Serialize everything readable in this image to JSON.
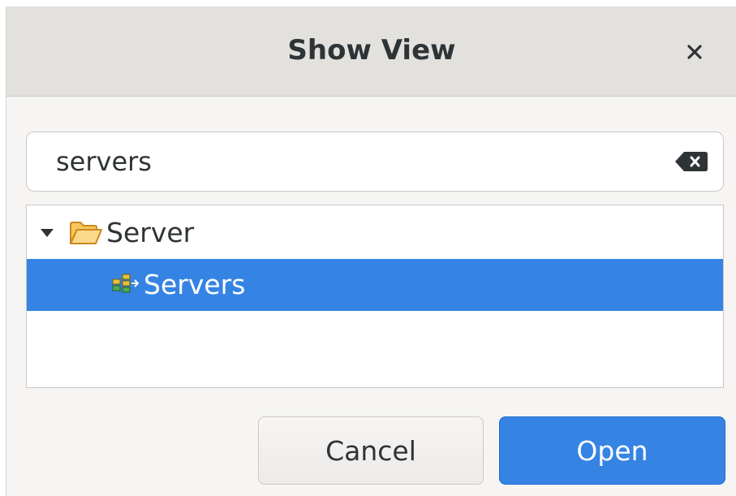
{
  "dialog": {
    "title": "Show View"
  },
  "search": {
    "value": "servers",
    "clear_icon": "clear-text-icon"
  },
  "tree": {
    "items": [
      {
        "label": "Server",
        "icon": "folder-open-icon",
        "expanded": true,
        "selected": false
      },
      {
        "label": "Servers",
        "icon": "servers-view-icon",
        "selected": true
      }
    ]
  },
  "buttons": {
    "cancel_label": "Cancel",
    "open_label": "Open"
  },
  "colors": {
    "accent": "#3584e4",
    "titlebar": "#e3e1de",
    "background": "#f6f5f4",
    "text": "#2e3436"
  }
}
